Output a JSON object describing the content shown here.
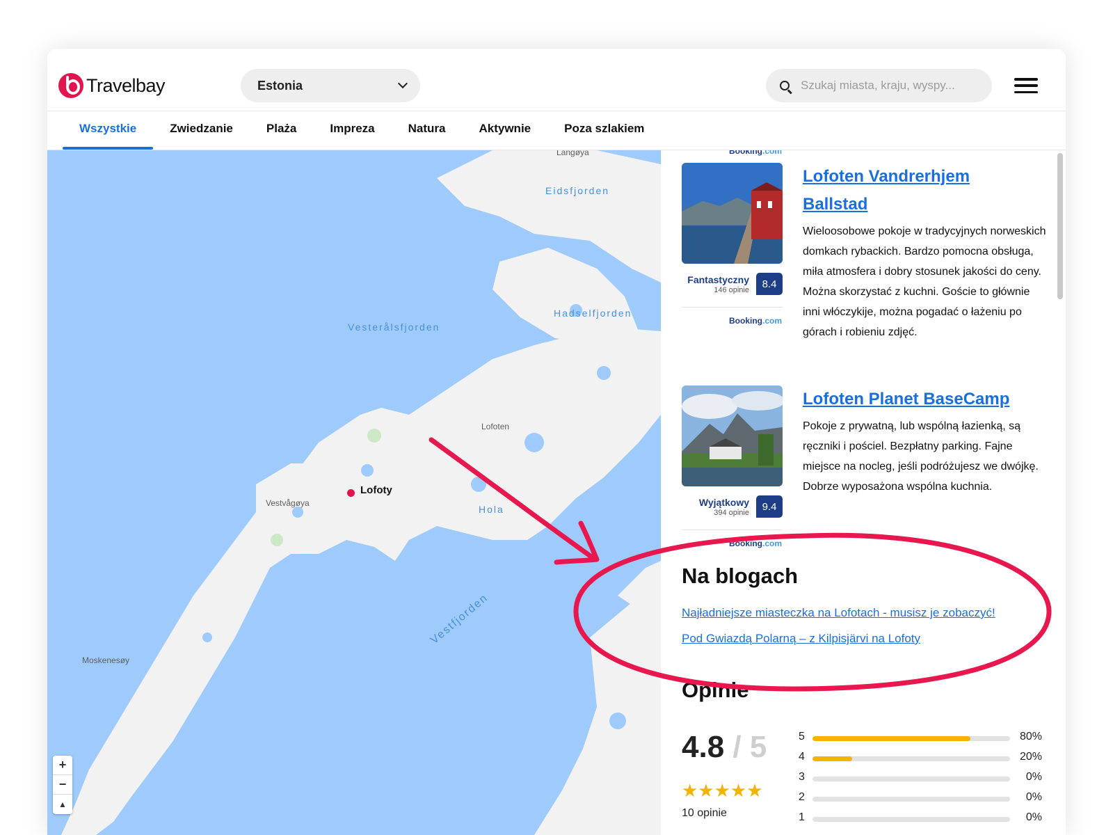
{
  "header": {
    "logo_text": "Travelbay",
    "country_select": {
      "value": "Estonia"
    },
    "search": {
      "placeholder": "Szukaj miasta, kraju, wyspy..."
    }
  },
  "tabs": [
    {
      "label": "Wszystkie",
      "active": true
    },
    {
      "label": "Zwiedzanie"
    },
    {
      "label": "Plaża"
    },
    {
      "label": "Impreza"
    },
    {
      "label": "Natura"
    },
    {
      "label": "Aktywnie"
    },
    {
      "label": "Poza szlakiem"
    }
  ],
  "map": {
    "place": "Lofoty",
    "labels": {
      "langoya": "Langøya",
      "eidsfjorden": "Eidsfjorden",
      "hadselfjorden": "Hadselfjorden",
      "vesteralsfjorden": "Vesterålsfjorden",
      "lofoten": "Lofoten",
      "vestvagoya": "Vestvågøya",
      "hola": "Hola",
      "moskenesoy": "Moskenesøy",
      "vestfjorden": "Vestfjorden"
    },
    "zoom_in": "+",
    "zoom_out": "−",
    "compass": "▲"
  },
  "booking_brand": {
    "name": "Booking",
    "suffix": ".com"
  },
  "hotels": [
    {
      "title": "Lofoten Vandrerhjem Ballstad",
      "description": "Wieloosobowe pokoje w tradycyjnych norweskich domkach rybackich. Bardzo pomocna obsługa, miła atmosfera i dobry stosunek jakości do ceny. Można skorzystać z kuchni. Goście to głównie inni włóczykije, można pogadać o łażeniu po górach i robieniu zdjęć.",
      "rating_word": "Fantastyczny",
      "rating_count": "146 opinie",
      "rating_score": "8.4"
    },
    {
      "title": "Lofoten Planet BaseCamp",
      "description": "Pokoje z prywatną, lub wspólną łazienką, są ręczniki i pościel. Bezpłatny parking. Fajne miejsce na nocleg, jeśli podróżujesz we dwójkę. Dobrze wyposażona wspólna kuchnia.",
      "rating_word": "Wyjątkowy",
      "rating_count": "394 opinie",
      "rating_score": "9.4"
    }
  ],
  "blogs": {
    "heading": "Na blogach",
    "links": [
      "Najładniejsze miasteczka na Lofotach - musisz je zobaczyć!",
      "Pod Gwiazdą Polarną – z Kilpisjärvi na Lofoty"
    ]
  },
  "reviews": {
    "heading": "Opinie",
    "score": "4.8",
    "score_max": "/ 5",
    "stars": "★★★★★",
    "count": "10 opinie",
    "distribution": [
      {
        "stars": "5",
        "percent": "80%",
        "fraction": 0.8
      },
      {
        "stars": "4",
        "percent": "20%",
        "fraction": 0.2
      },
      {
        "stars": "3",
        "percent": "0%",
        "fraction": 0
      },
      {
        "stars": "2",
        "percent": "0%",
        "fraction": 0
      },
      {
        "stars": "1",
        "percent": "0%",
        "fraction": 0
      }
    ]
  },
  "colors": {
    "accent": "#1a6fdc",
    "brand": "#e2134d",
    "booking": "#1d3e86",
    "star": "#f3b400",
    "water": "#9ecbfb",
    "land": "#f2f2f2",
    "annotation": "#e8184f"
  }
}
